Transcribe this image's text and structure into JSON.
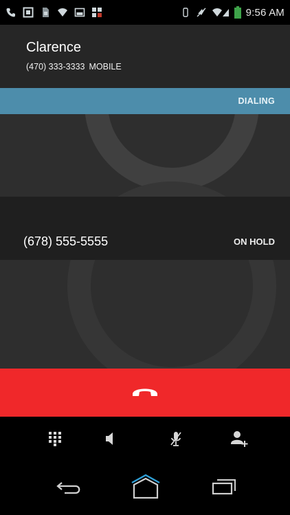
{
  "status_bar": {
    "time": "9:56 AM",
    "icons_left": [
      "phone-icon",
      "photo-icon",
      "sim-icon",
      "wifi-icon",
      "image-icon",
      "qr-icon"
    ],
    "icons_right": [
      "vibrate-icon",
      "mute-icon",
      "wifi-signal-icon",
      "battery-icon"
    ]
  },
  "active_call": {
    "name": "Clarence",
    "number": "(470) 333-3333",
    "number_type": "MOBILE",
    "status": "DIALING"
  },
  "held_call": {
    "number": "(678) 555-5555",
    "status": "ON HOLD"
  },
  "actions": {
    "end_call": "end-call-icon",
    "dialpad": "dialpad-icon",
    "speaker": "speaker-icon",
    "mute": "mute-mic-icon",
    "add_call": "add-call-icon"
  },
  "colors": {
    "dialing_strip": "#4d8dab",
    "end_call": "#f0282a",
    "call_background": "#2e2e2e"
  }
}
